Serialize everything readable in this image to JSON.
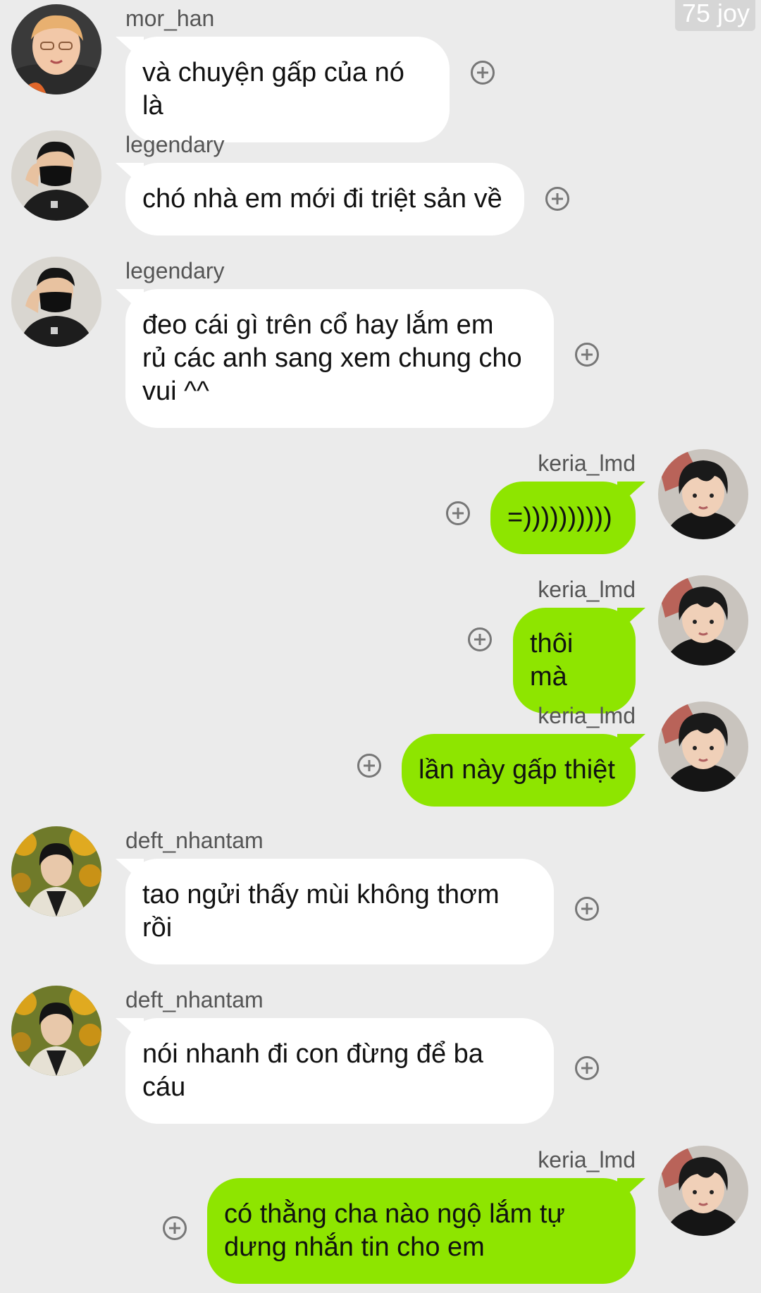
{
  "watermark": "75 joy",
  "messages": [
    {
      "direction": "incoming",
      "username": "mor_han",
      "avatar": "morhan",
      "text": "và chuyện gấp của nó là"
    },
    {
      "direction": "incoming",
      "username": "legendary",
      "avatar": "legendary",
      "text": "chó nhà em mới đi triệt sản về"
    },
    {
      "direction": "incoming",
      "username": "legendary",
      "avatar": "legendary",
      "text": "đeo cái gì trên cổ hay lắm em\nrủ các anh sang xem chung cho\nvui ^^"
    },
    {
      "direction": "outgoing",
      "username": "keria_lmd",
      "avatar": "keria",
      "text": "=))))))))))"
    },
    {
      "direction": "outgoing",
      "username": "keria_lmd",
      "avatar": "keria",
      "text": "thôi mà"
    },
    {
      "direction": "outgoing",
      "username": "keria_lmd",
      "avatar": "keria",
      "text": "lần này gấp thiệt"
    },
    {
      "direction": "incoming",
      "username": "deft_nhantam",
      "avatar": "deft",
      "text": "tao ngửi thấy mùi không thơm\nrồi"
    },
    {
      "direction": "incoming",
      "username": "deft_nhantam",
      "avatar": "deft",
      "text": "nói nhanh đi con đừng để ba\ncáu"
    },
    {
      "direction": "outgoing",
      "username": "keria_lmd",
      "avatar": "keria",
      "text": "có thằng cha nào ngộ lắm tự\ndưng nhắn tin cho em"
    }
  ],
  "icons": {
    "add_reaction": "plus-circle-icon"
  },
  "colors": {
    "background": "#ebebeb",
    "incoming_bubble": "#ffffff",
    "outgoing_bubble": "#8ee500",
    "username_text": "#555555",
    "message_text": "#111111"
  }
}
